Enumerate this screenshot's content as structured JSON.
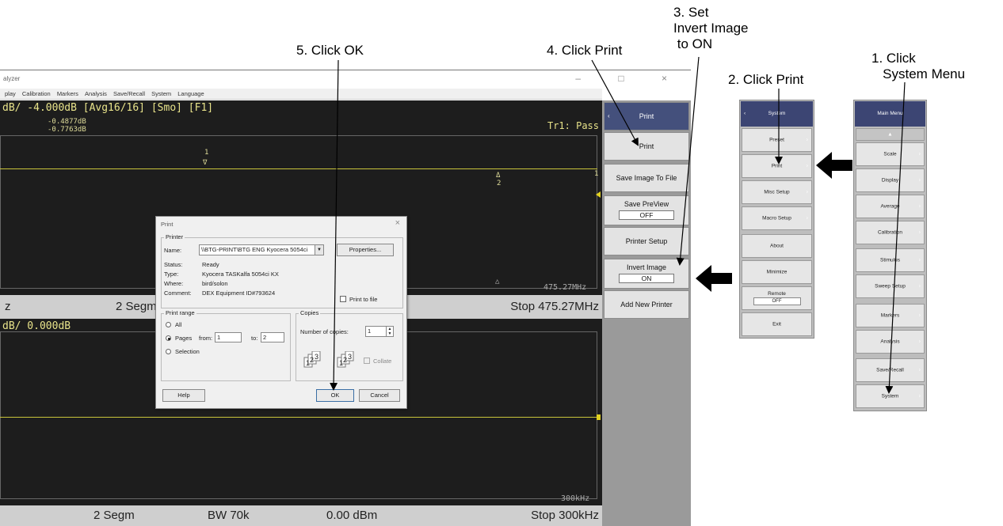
{
  "callouts": {
    "step1": "1. Click\n   System Menu",
    "step2": "2. Click Print",
    "step3": "3. Set\nInvert Image\n to ON",
    "step4": "4. Click Print",
    "step5": "5. Click OK"
  },
  "window": {
    "title": "alyzer",
    "controls": "– □ ×",
    "menu": [
      "play",
      "Calibration",
      "Markers",
      "Analysis",
      "Save/Recall",
      "System",
      "Language"
    ]
  },
  "trace1": {
    "header": "dB/ -4.000dB [Avg16/16] [Smo]  [F1]",
    "marker_vals": [
      "-0.4877dB",
      "-0.7763dB"
    ],
    "marker1_label": "1",
    "marker1_symbol": "∇",
    "marker2_symbol": "Δ",
    "marker2_label": "2",
    "marker_small": "△",
    "pass": "Tr1: Pass",
    "freq": "475.27MHz",
    "right_label": "1"
  },
  "status1": {
    "left": "z",
    "mid": "2 Segm",
    "right": "Stop 475.27MHz"
  },
  "trace2": {
    "header": "dB/ 0.000dB",
    "freq": "300kHz"
  },
  "status2": {
    "mid": "2 Segm",
    "bw": "BW 70k",
    "power": "0.00 dBm",
    "right": "Stop 300kHz"
  },
  "softkeys": {
    "title": "Print",
    "print": "Print",
    "save_image": "Save Image To File",
    "save_preview": "Save PreView",
    "save_preview_val": "OFF",
    "printer_setup": "Printer Setup",
    "invert_image": "Invert Image",
    "invert_image_val": "ON",
    "add_printer": "Add New Printer"
  },
  "dialog": {
    "title": "Print",
    "close": "×",
    "printer_group": "Printer",
    "name_label": "Name:",
    "name_value": "\\\\BTG-PRINT\\BTG ENG Kyocera 5054ci",
    "properties": "Properties...",
    "status_label": "Status:",
    "status_value": "Ready",
    "type_label": "Type:",
    "type_value": "Kyocera TASKalfa 5054ci KX",
    "where_label": "Where:",
    "where_value": "bird/solon",
    "comment_label": "Comment:",
    "comment_value": "DEX Equipment ID#793624",
    "print_to_file": "Print to file",
    "range_group": "Print range",
    "all": "All",
    "pages": "Pages",
    "from_label": "from:",
    "from_value": "1",
    "to_label": "to:",
    "to_value": "2",
    "selection": "Selection",
    "copies_group": "Copies",
    "num_copies": "Number of copies:",
    "copies_value": "1",
    "collate": "Collate",
    "help": "Help",
    "ok": "OK",
    "cancel": "Cancel"
  },
  "system_menu": {
    "title": "System",
    "items": [
      "Preset",
      "Print",
      "Misc Setup",
      "Macro Setup",
      "About",
      "Minimize",
      "Remote",
      "Exit"
    ],
    "remote_val": "OFF"
  },
  "main_menu": {
    "title": "Main Menu",
    "up": "▲",
    "items": [
      "Scale",
      "Display",
      "Average",
      "Calibration",
      "Stimulus",
      "Sweep Setup",
      "Markers",
      "Analysis",
      "Save/Recall",
      "System"
    ]
  },
  "colors": {
    "trace_bg": "#1d1d1d",
    "trace_text": "#e8e38a",
    "menu_header": "#3c4573"
  }
}
